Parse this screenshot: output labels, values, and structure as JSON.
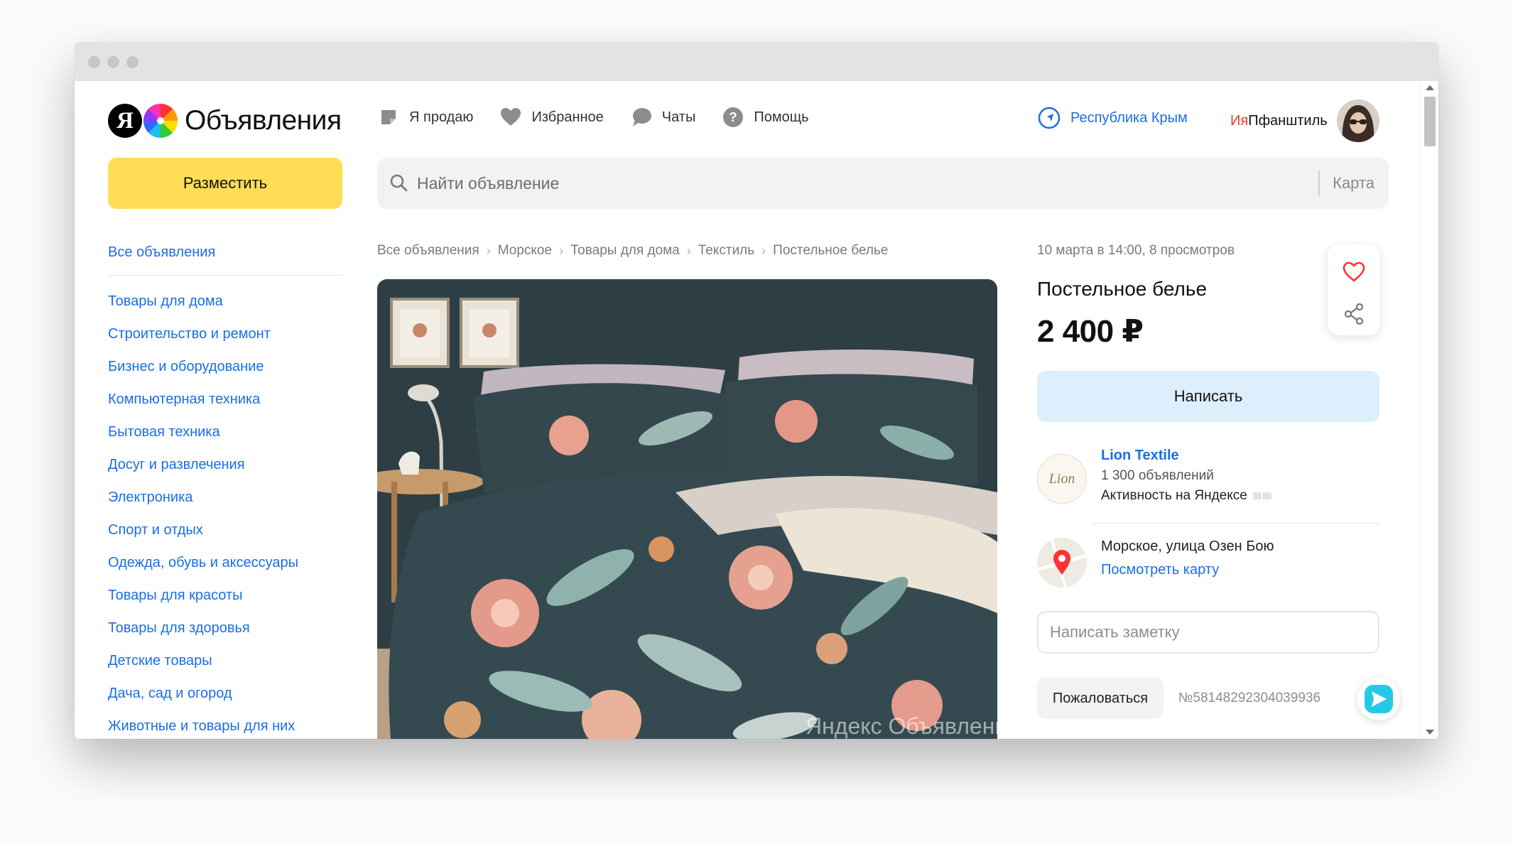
{
  "header": {
    "logo_text": "Объявления",
    "logo_letter": "Я",
    "nav": [
      {
        "label": "Я продаю",
        "icon": "sticker-icon"
      },
      {
        "label": "Избранное",
        "icon": "heart-icon"
      },
      {
        "label": "Чаты",
        "icon": "chat-icon"
      },
      {
        "label": "Помощь",
        "icon": "help-icon"
      }
    ],
    "region": "Республика Крым",
    "user_first": "Ия",
    "user_last": " Пфанштиль"
  },
  "sidebar": {
    "post_button": "Разместить",
    "all_ads": "Все объявления",
    "categories": [
      "Товары для дома",
      "Строительство и ремонт",
      "Бизнес и оборудование",
      "Компьютерная техника",
      "Бытовая техника",
      "Досуг и развлечения",
      "Электроника",
      "Спорт и отдых",
      "Одежда, обувь и аксессуары",
      "Товары для красоты",
      "Товары для здоровья",
      "Детские товары",
      "Дача, сад и огород",
      "Животные и товары для них"
    ]
  },
  "search": {
    "placeholder": "Найти объявление",
    "map_label": "Карта"
  },
  "breadcrumbs": [
    "Все объявления",
    "Морское",
    "Товары для дома",
    "Текстиль",
    "Постельное белье"
  ],
  "listing": {
    "date_views": "10 марта в 14:00, 8 просмотров",
    "title": "Постельное белье",
    "price": "2 400 ₽",
    "watermark": "Яндекс Объявления",
    "write_button": "Написать",
    "seller": {
      "name": "Lion Textile",
      "logo_text": "Lion",
      "ads_count": "1 300 объявлений",
      "activity": "Активность на Яндексе"
    },
    "location": {
      "address": "Морское, улица Озен Бою",
      "map_link": "Посмотреть карту"
    },
    "note_placeholder": "Написать заметку",
    "complain_button": "Пожаловаться",
    "ad_number": "№58148292304039936"
  },
  "colors": {
    "accent_yellow": "#ffdd55",
    "link_blue": "#1a6fe6",
    "write_button_bg": "#ddeefd",
    "favorite_red": "#f33"
  }
}
